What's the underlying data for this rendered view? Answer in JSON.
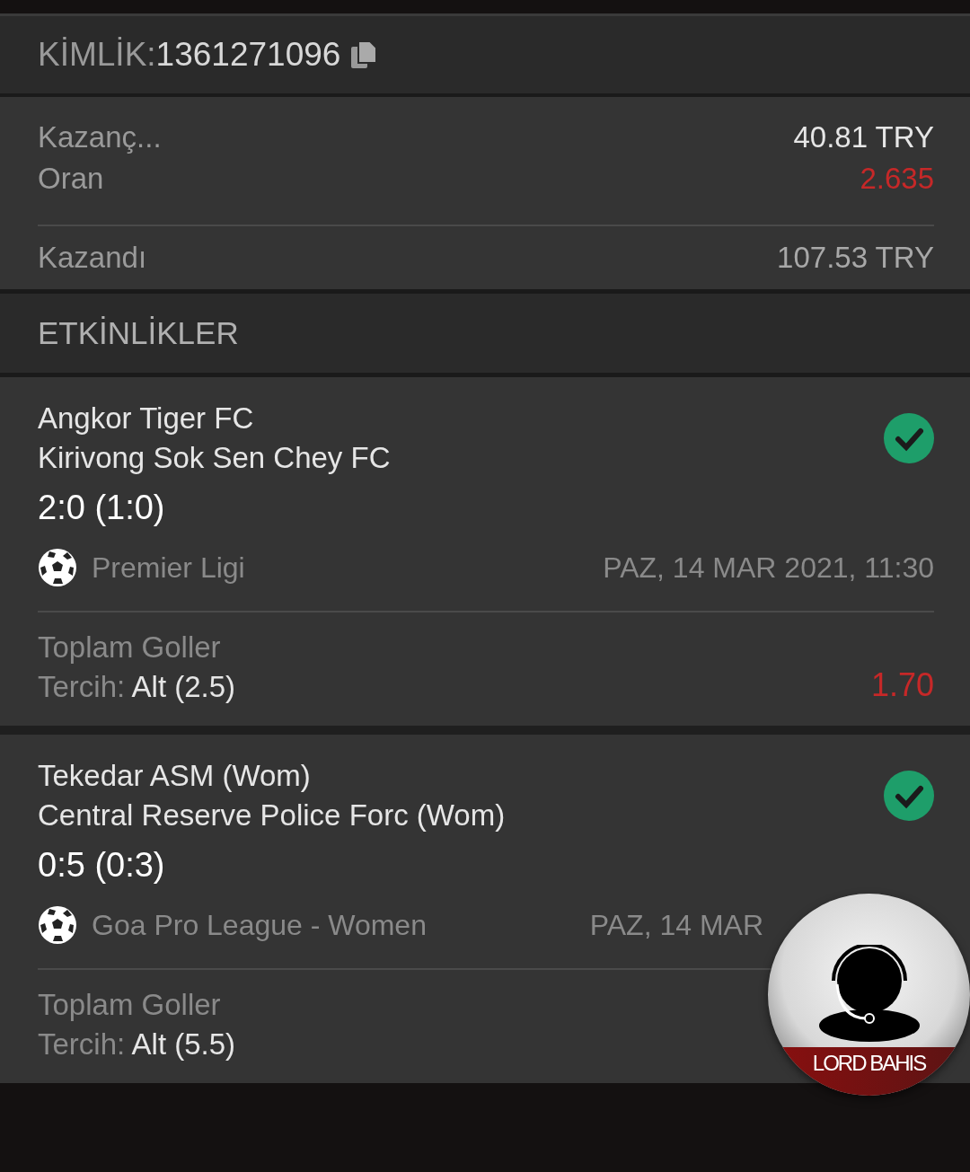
{
  "id_bar": {
    "label": "KİMLİK:",
    "value": "1361271096"
  },
  "summary": [
    {
      "label": "Kazanç...",
      "value": "40.81 TRY",
      "kind": "plain"
    },
    {
      "label": "Oran",
      "value": "2.635",
      "kind": "odds"
    },
    {
      "label": "Kazandı",
      "value": "107.53 TRY",
      "kind": "total"
    }
  ],
  "events_header": "ETKİNLİKLER",
  "events": [
    {
      "home": "Angkor Tiger FC",
      "away": "Kirivong Sok Sen Chey FC",
      "score": "2:0 (1:0)",
      "won": true,
      "league": "Premier Ligi",
      "date": "PAZ, 14 MAR 2021, 11:30",
      "market": "Toplam Goller",
      "pick_label": "Tercih:",
      "pick": "Alt (2.5)",
      "odds": "1.70"
    },
    {
      "home": "Tekedar ASM (Wom)",
      "away": "Central Reserve Police Forc (Wom)",
      "score": "0:5 (0:3)",
      "won": true,
      "league": "Goa Pro League - Women",
      "date": "PAZ, 14 MAR",
      "market": "Toplam Goller",
      "pick_label": "Tercih:",
      "pick": "Alt (5.5)"
    }
  ],
  "support_button": {
    "brand": "LORD BAHIS"
  }
}
